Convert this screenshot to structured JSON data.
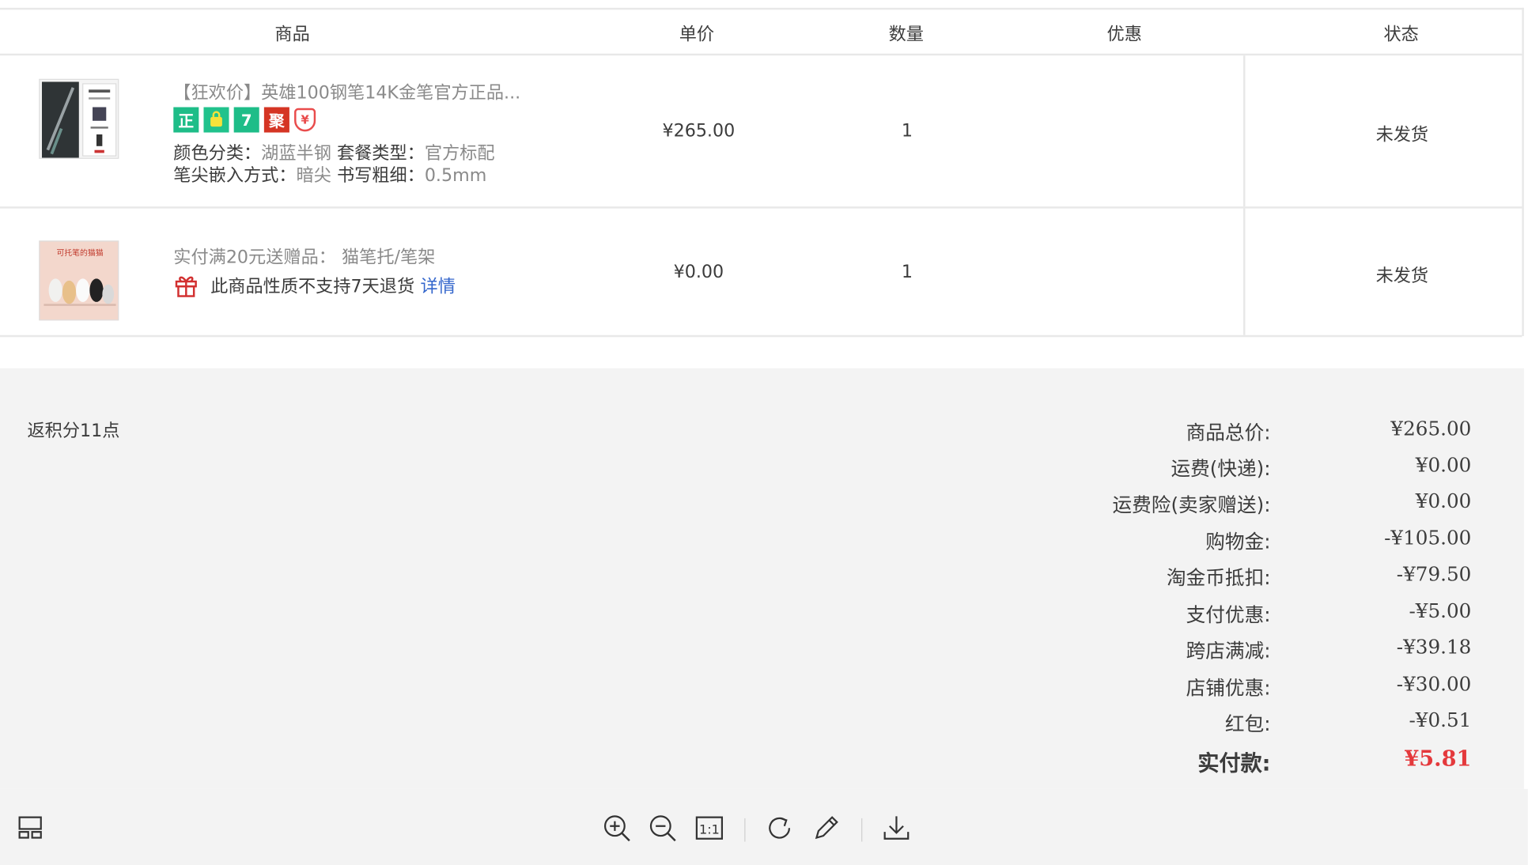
{
  "table": {
    "headers": [
      "商品",
      "单价",
      "数量",
      "优惠",
      "状态"
    ],
    "rows": [
      {
        "title": "【狂欢价】英雄100钢笔14K金笔官方正品...",
        "badges": [
          "正",
          "🛍",
          "7",
          "聚",
          "¥"
        ],
        "sku1_label": "颜色分类：",
        "sku1_value": "湖蓝半钢",
        "sku2_label": "套餐类型：",
        "sku2_value": "官方标配",
        "sku3_label": "笔尖嵌入方式：",
        "sku3_value": "暗尖",
        "sku4_label": "书写粗细：",
        "sku4_value": "0.5mm",
        "price": "¥265.00",
        "qty": "1",
        "discount": "",
        "status": "未发货",
        "image_icon": "pen-product-image"
      },
      {
        "title": "实付满20元送赠品： 猫笔托/笔架",
        "notice": "此商品性质不支持7天退货",
        "detail_link": "详情",
        "price": "¥0.00",
        "qty": "1",
        "discount": "",
        "status": "未发货",
        "image_icon": "cat-pen-holder-image",
        "image_caption": "可托笔的猫猫"
      }
    ]
  },
  "summary": {
    "points": "返积分11点",
    "lines": [
      {
        "label": "商品总价:",
        "value": "¥265.00"
      },
      {
        "label": "运费(快递):",
        "value": "¥0.00"
      },
      {
        "label": "运费险(卖家赠送):",
        "value": "¥0.00"
      },
      {
        "label": "购物金:",
        "value": "-¥105.00"
      },
      {
        "label": "淘金币抵扣:",
        "value": "-¥79.50"
      },
      {
        "label": "支付优惠:",
        "value": "-¥5.00"
      },
      {
        "label": "跨店满减:",
        "value": "-¥39.18"
      },
      {
        "label": "店铺优惠:",
        "value": "-¥30.00"
      },
      {
        "label": "红包:",
        "value": "-¥0.51"
      }
    ],
    "total_label": "实付款:",
    "total_value": "¥5.81"
  },
  "toolbar": {
    "icons": [
      "layout-icon",
      "zoom-in-icon",
      "zoom-out-icon",
      "actual-size-icon",
      "rotate-icon",
      "edit-icon",
      "download-icon"
    ],
    "actual_size_label": "1:1"
  },
  "colors": {
    "accent_red": "#e4393c",
    "link_blue": "#3366cc",
    "badge_green": "#1ebd88",
    "badge_red": "#d53524"
  }
}
